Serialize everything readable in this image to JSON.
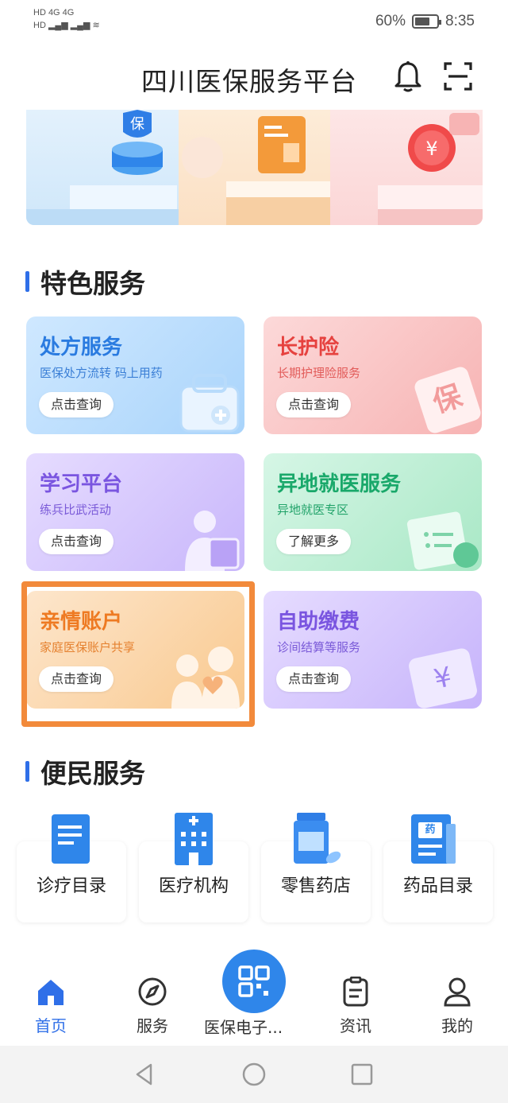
{
  "status": {
    "sig_left": "HD 4G 4G",
    "battery": "60%",
    "time": "8:35"
  },
  "header": {
    "title": "四川医保服务平台"
  },
  "banner": {
    "badge": "保",
    "coin": "¥"
  },
  "featured": {
    "title": "特色服务",
    "cards": [
      {
        "title": "处方服务",
        "sub": "医保处方流转 码上用药",
        "btn": "点击查询"
      },
      {
        "title": "长护险",
        "sub": "长期护理险服务",
        "btn": "点击查询",
        "mark": "保"
      },
      {
        "title": "学习平台",
        "sub": "练兵比武活动",
        "btn": "点击查询"
      },
      {
        "title": "异地就医服务",
        "sub": "异地就医专区",
        "btn": "了解更多"
      },
      {
        "title": "亲情账户",
        "sub": "家庭医保账户共享",
        "btn": "点击查询"
      },
      {
        "title": "自助缴费",
        "sub": "诊间结算等服务",
        "btn": "点击查询",
        "mark": "¥"
      }
    ]
  },
  "convenience": {
    "title": "便民服务",
    "tiles": [
      {
        "label": "诊疗目录"
      },
      {
        "label": "医疗机构"
      },
      {
        "label": "零售药店"
      },
      {
        "label": "药品目录",
        "badge": "药"
      }
    ]
  },
  "tabs": [
    {
      "label": "首页"
    },
    {
      "label": "服务"
    },
    {
      "label": "医保电子..."
    },
    {
      "label": "资讯"
    },
    {
      "label": "我的"
    }
  ],
  "colors": {
    "accent": "#2f6fe8",
    "highlight": "#f28a3b"
  }
}
